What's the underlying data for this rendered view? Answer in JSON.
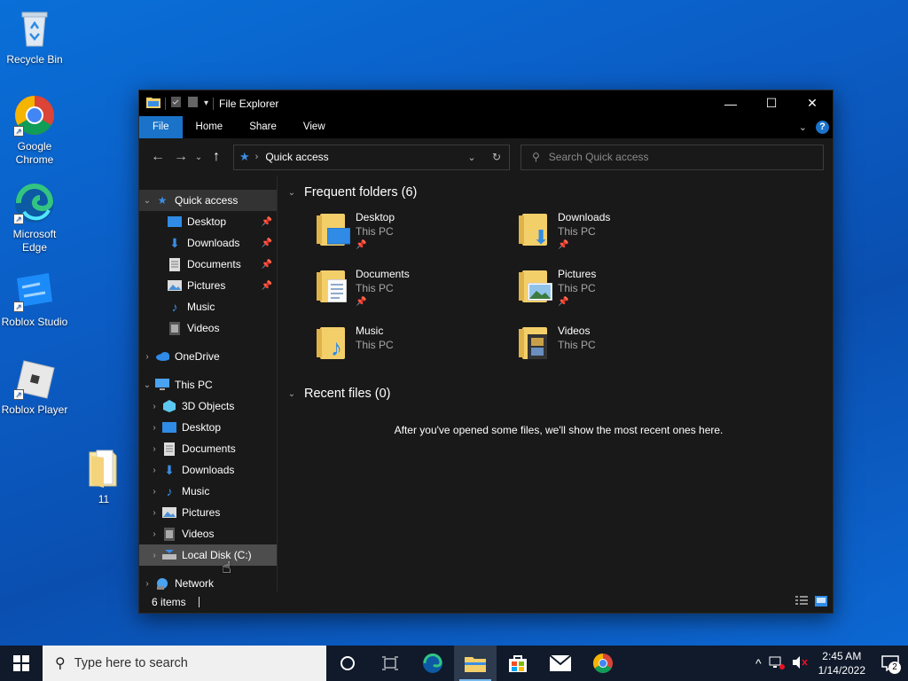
{
  "desktop": {
    "icons": [
      {
        "label": "Recycle Bin"
      },
      {
        "label": "Google\nChrome"
      },
      {
        "label": "Microsoft\nEdge"
      },
      {
        "label": "Roblox Studio"
      },
      {
        "label": "Roblox Player"
      },
      {
        "label": "11"
      }
    ]
  },
  "window": {
    "title": "File Explorer",
    "controls": {
      "minimize": "—",
      "maximize": "☐",
      "close": "✕"
    },
    "ribbon_tabs": [
      "File",
      "Home",
      "Share",
      "View"
    ],
    "address": {
      "location": "Quick access"
    },
    "search": {
      "placeholder": "Search Quick access"
    },
    "nav": {
      "quick_access": "Quick access",
      "quick_items": [
        "Desktop",
        "Downloads",
        "Documents",
        "Pictures",
        "Music",
        "Videos"
      ],
      "onedrive": "OneDrive",
      "this_pc": "This PC",
      "pc_items": [
        "3D Objects",
        "Desktop",
        "Documents",
        "Downloads",
        "Music",
        "Pictures",
        "Videos",
        "Local Disk (C:)"
      ],
      "network": "Network"
    },
    "frequent": {
      "header": "Frequent folders (6)",
      "folders": [
        {
          "name": "Desktop",
          "location": "This PC",
          "pinned": true
        },
        {
          "name": "Downloads",
          "location": "This PC",
          "pinned": true
        },
        {
          "name": "Documents",
          "location": "This PC",
          "pinned": true
        },
        {
          "name": "Pictures",
          "location": "This PC",
          "pinned": true
        },
        {
          "name": "Music",
          "location": "This PC",
          "pinned": false
        },
        {
          "name": "Videos",
          "location": "This PC",
          "pinned": false
        }
      ]
    },
    "recent": {
      "header": "Recent files (0)",
      "empty_message": "After you've opened some files, we'll show the most recent ones here."
    },
    "status": {
      "items": "6 items"
    }
  },
  "taskbar": {
    "search_placeholder": "Type here to search",
    "time": "2:45 AM",
    "date": "1/14/2022",
    "notifications": "2"
  },
  "colors": {
    "accent": "#1a73c9",
    "window_bg": "#191919",
    "taskbar": "#101a2b"
  }
}
